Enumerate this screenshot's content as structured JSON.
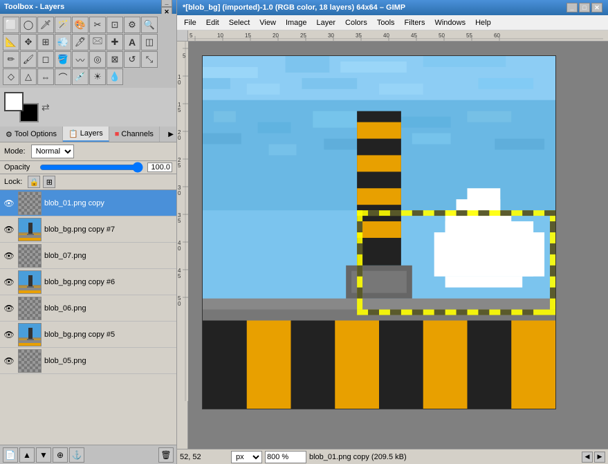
{
  "toolbox": {
    "title": "Toolbox - Layers",
    "tools": [
      {
        "name": "rect-select",
        "icon": "⬜",
        "title": "Rectangle Select"
      },
      {
        "name": "ellipse-select",
        "icon": "⭕",
        "title": "Ellipse Select"
      },
      {
        "name": "free-select",
        "icon": "🔗",
        "title": "Free Select"
      },
      {
        "name": "fuzzy-select",
        "icon": "🪄",
        "title": "Fuzzy Select"
      },
      {
        "name": "scissors",
        "icon": "✂",
        "title": "Scissors"
      },
      {
        "name": "color-select",
        "icon": "🎨",
        "title": "Color Select"
      },
      {
        "name": "crop",
        "icon": "⊞",
        "title": "Crop"
      },
      {
        "name": "transform",
        "icon": "↺",
        "title": "Transform"
      },
      {
        "name": "flip",
        "icon": "⇔",
        "title": "Flip"
      },
      {
        "name": "text",
        "icon": "Ⓣ",
        "title": "Text"
      },
      {
        "name": "pencil-icon",
        "icon": "✏",
        "title": "Pencil"
      },
      {
        "name": "paint-icon",
        "icon": "🖌",
        "title": "Paint"
      },
      {
        "name": "eraser",
        "icon": "◻",
        "title": "Eraser"
      },
      {
        "name": "airbrush",
        "icon": "💨",
        "title": "Airbrush"
      },
      {
        "name": "clone",
        "icon": "©",
        "title": "Clone"
      },
      {
        "name": "heal",
        "icon": "✚",
        "title": "Heal"
      },
      {
        "name": "perspective",
        "icon": "△",
        "title": "Perspective"
      },
      {
        "name": "shear",
        "icon": "◇",
        "title": "Shear"
      },
      {
        "name": "move",
        "icon": "✥",
        "title": "Move"
      },
      {
        "name": "zoom-tool",
        "icon": "🔍",
        "title": "Zoom"
      },
      {
        "name": "measure",
        "icon": "📐",
        "title": "Measure"
      },
      {
        "name": "align",
        "icon": "⊞",
        "title": "Align"
      },
      {
        "name": "path",
        "icon": "⌒",
        "title": "Path"
      },
      {
        "name": "color-picker",
        "icon": "💉",
        "title": "Color Picker"
      },
      {
        "name": "bucket-fill",
        "icon": "🪣",
        "title": "Bucket Fill"
      },
      {
        "name": "blend",
        "icon": "◫",
        "title": "Blend"
      },
      {
        "name": "dodge-burn",
        "icon": "☀",
        "title": "Dodge/Burn"
      },
      {
        "name": "smudge",
        "icon": "〰",
        "title": "Smudge"
      },
      {
        "name": "convolve",
        "icon": "◎",
        "title": "Convolve"
      },
      {
        "name": "ink",
        "icon": "🖊",
        "title": "Ink"
      },
      {
        "name": "water",
        "icon": "💧",
        "title": "Water"
      }
    ]
  },
  "panels": {
    "tool_options_label": "Tool Options",
    "layers_label": "Layers",
    "channels_label": "Channels"
  },
  "tool_options": {
    "mode_label": "Mode:",
    "mode_value": "Normal",
    "opacity_label": "Opacity",
    "opacity_value": "100.0",
    "lock_label": "Lock:"
  },
  "layers": [
    {
      "name": "blob_01.png copy",
      "visible": true,
      "thumb_type": "checker",
      "active": true
    },
    {
      "name": "blob_bg.png copy #7",
      "visible": true,
      "thumb_type": "tower",
      "active": false
    },
    {
      "name": "blob_07.png",
      "visible": true,
      "thumb_type": "checker",
      "active": false
    },
    {
      "name": "blob_bg.png copy #6",
      "visible": true,
      "thumb_type": "tower",
      "active": false
    },
    {
      "name": "blob_06.png",
      "visible": true,
      "thumb_type": "checker",
      "active": false
    },
    {
      "name": "blob_bg.png copy #5",
      "visible": true,
      "thumb_type": "tower",
      "active": false
    },
    {
      "name": "blob_05.png",
      "visible": true,
      "thumb_type": "checker",
      "active": false
    }
  ],
  "gimp": {
    "title": "*[blob_bg] (imported)-1.0 (RGB color, 18 layers) 64x64 – GIMP",
    "menu": {
      "file": "File",
      "edit": "Edit",
      "select": "Select",
      "view": "View",
      "image": "Image",
      "layer": "Layer",
      "colors": "Colors",
      "tools": "Tools",
      "filters": "Filters",
      "windows": "Windows",
      "help": "Help"
    }
  },
  "status_bar": {
    "coords": "52, 52",
    "unit": "px",
    "zoom": "800 %",
    "filename": "blob_01.png copy (209.5 kB)"
  },
  "ruler": {
    "h_ticks": [
      "5",
      "10",
      "15",
      "20",
      "25",
      "30",
      "35",
      "40",
      "45",
      "50",
      "55",
      "60"
    ],
    "v_ticks": [
      "5",
      "10",
      "15",
      "20",
      "25",
      "30",
      "35",
      "40",
      "45",
      "50"
    ]
  }
}
